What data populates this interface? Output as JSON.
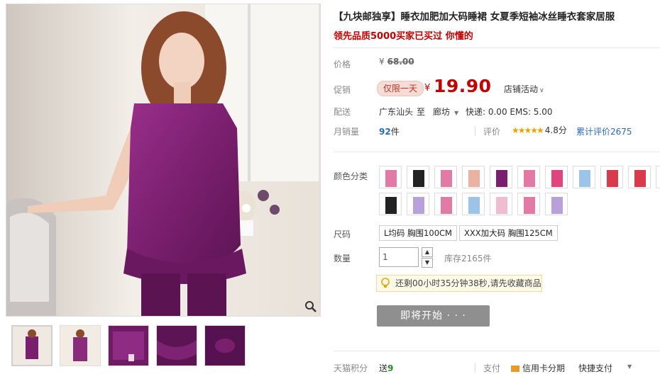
{
  "product": {
    "title": "【九块邮独享】睡衣加肥加大码睡裙 女夏季短袖冰丝睡衣套家居服",
    "subtitle": "领先品质5000买家已买过 你懂的"
  },
  "pricing": {
    "price_label": "价格",
    "original_currency": "¥",
    "original_price": "68.00",
    "promo_label": "促销",
    "promo_badge": "仅限一天",
    "currency": "¥",
    "promo_price": "19.90",
    "shop_activity": "店铺活动"
  },
  "shipping": {
    "label": "配送",
    "from": "广东汕头",
    "to_word": "至",
    "destination": "廊坊",
    "fee": "快递: 0.00 EMS: 5.00"
  },
  "sales": {
    "label": "月销量",
    "count": "92",
    "unit": "件",
    "rating_label": "评价",
    "stars": "★★★★★",
    "score": "4.8分",
    "reviews": "累计评价2675"
  },
  "options": {
    "color_label": "颜色分类",
    "colors": [
      "pink",
      "black",
      "pink",
      "peach",
      "purple",
      "pink",
      "hot-pink",
      "light-blue",
      "red",
      "red",
      "purple",
      "black",
      "lavender",
      "pink",
      "light-blue",
      "light-pink",
      "pink",
      "lavender"
    ],
    "size_label": "尺码",
    "sizes": [
      "L均码 胸围100CM",
      "XXX加大码 胸围125CM"
    ]
  },
  "quantity": {
    "label": "数量",
    "value": "1",
    "stock": "库存2165件"
  },
  "notice": {
    "text": "还剩00小时35分钟38秒,请先收藏商品"
  },
  "buy_button": {
    "label": "即将开始 · · ·"
  },
  "footer": {
    "points_label": "天猫积分",
    "points_value": "送",
    "points_num": "9",
    "pay_label": "支付",
    "pay_card": "信用卡分期",
    "pay_fast": "快捷支付"
  },
  "colors": {
    "accent_red": "#c40000",
    "promo_bg": "#f6dcd6",
    "button_gray": "#8f8f8f",
    "dress_purple": "#7a1f6e"
  }
}
